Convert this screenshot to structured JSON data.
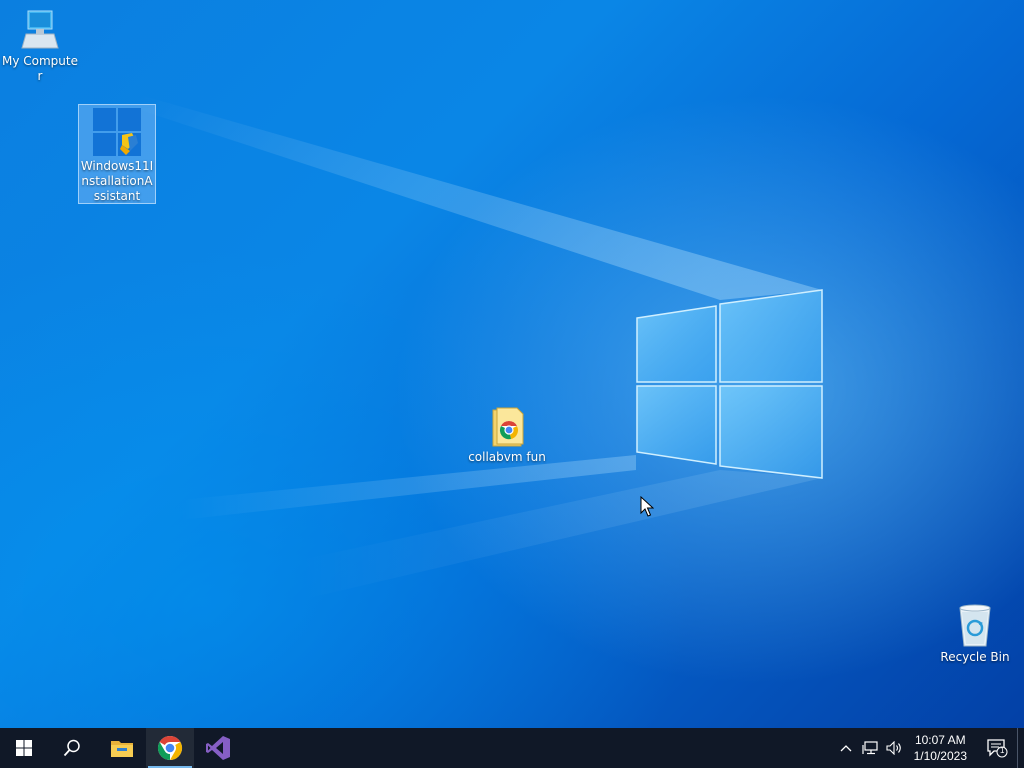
{
  "desktop": {
    "icons": [
      {
        "name": "my-computer",
        "label": "My Computer"
      },
      {
        "name": "windows11-installation-assistant",
        "label": "Windows11InstallationAssistant"
      },
      {
        "name": "collabvm-fun",
        "label": "collabvm fun"
      },
      {
        "name": "recycle-bin",
        "label": "Recycle Bin"
      }
    ],
    "wallpaper_accent": "#0a6fd6"
  },
  "taskbar": {
    "background": "#101827",
    "buttons": [
      {
        "name": "start-button",
        "icon": "windows-logo-icon"
      },
      {
        "name": "search-button",
        "icon": "search-icon"
      },
      {
        "name": "file-explorer-button",
        "icon": "folder-icon"
      },
      {
        "name": "chrome-button",
        "icon": "chrome-icon",
        "active": true
      },
      {
        "name": "visual-studio-button",
        "icon": "visual-studio-icon"
      }
    ],
    "tray": {
      "icons": [
        "chevron-up-icon",
        "network-icon",
        "volume-icon"
      ],
      "time": "10:07 AM",
      "date": "1/10/2023",
      "notification_count": "1"
    }
  }
}
